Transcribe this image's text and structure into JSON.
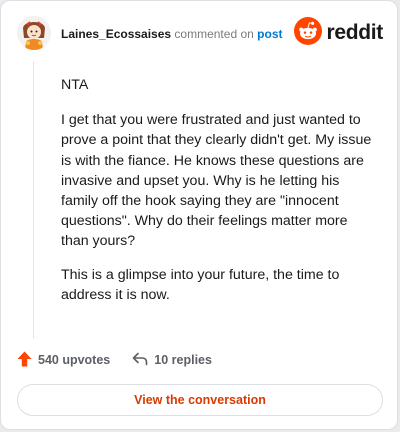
{
  "header": {
    "username": "Laines_Ecossaises",
    "action_text": "commented on",
    "post_link": "post",
    "brand": "reddit"
  },
  "comment": {
    "paragraphs": [
      "NTA",
      "I get that you were frustrated and just wanted to prove a point that they clearly didn't get. My issue is with the fiance. He knows these questions are invasive and upset you. Why is he letting his family off the hook saying they are \"innocent questions\". Why do their feelings matter more than yours?",
      "This is a glimpse into your future, the time to address it is now."
    ]
  },
  "actions": {
    "upvotes": "540 upvotes",
    "replies": "10 replies",
    "upvote_icon": "upvote-arrow-icon",
    "reply_icon": "reply-arrow-icon"
  },
  "cta": {
    "label": "View the conversation"
  },
  "colors": {
    "brand_orange": "#ff4500",
    "link_blue": "#0079d3",
    "cta_text": "#d93a00"
  }
}
